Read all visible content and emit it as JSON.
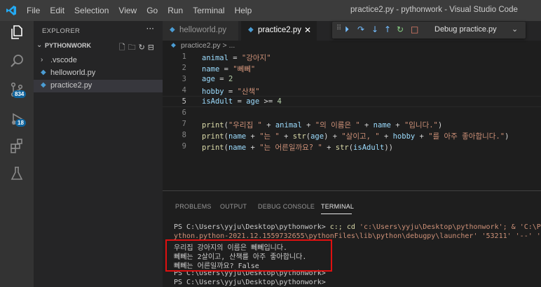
{
  "menu": [
    "File",
    "Edit",
    "Selection",
    "View",
    "Go",
    "Run",
    "Terminal",
    "Help"
  ],
  "window_title": "practice2.py - pythonwork - Visual Studio Code",
  "activity": {
    "scm_badge": "834",
    "debug_badge": "18"
  },
  "sidebar": {
    "title": "EXPLORER",
    "more": "···",
    "folder": "PYTHONWORK",
    "items": [
      {
        "label": ".vscode",
        "kind": "folder"
      },
      {
        "label": "helloworld.py",
        "kind": "python"
      },
      {
        "label": "practice2.py",
        "kind": "python"
      }
    ]
  },
  "tabs": [
    {
      "label": "helloworld.py",
      "active": false
    },
    {
      "label": "practice2.py",
      "active": true
    }
  ],
  "debug": {
    "config": "Debug practice.py"
  },
  "breadcrumb": "practice2.py > ...",
  "code_lines": [
    {
      "n": "1",
      "text": "animal = \"강아지\""
    },
    {
      "n": "2",
      "text": "name = \"뻬뻬\""
    },
    {
      "n": "3",
      "text": "age = 2"
    },
    {
      "n": "4",
      "text": "hobby = \"산책\""
    },
    {
      "n": "5",
      "text": "isAdult = age >= 4"
    },
    {
      "n": "6",
      "text": ""
    },
    {
      "n": "7",
      "text": "print(\"우리집 \" + animal + \"의 이름은 \" + name + \"입니다.\")"
    },
    {
      "n": "8",
      "text": "print(name + \"는 \" + str(age) + \"살이고, \" + hobby + \"를 아주 좋아합니다.\")"
    },
    {
      "n": "9",
      "text": "print(name + \"는 어른일까요? \" + str(isAdult))"
    }
  ],
  "panel": {
    "tabs": [
      "PROBLEMS",
      "OUTPUT",
      "DEBUG CONSOLE",
      "TERMINAL"
    ],
    "active_tab": "TERMINAL",
    "terminal": {
      "line1_prompt": "PS C:\\Users\\yyju\\Desktop\\pythonwork> ",
      "line1_cmd": "c:; cd ",
      "line1_rest": "'c:\\Users\\yyju\\Desktop\\pythonwork'; & 'C:\\Pyt",
      "line2": "ython.python-2021.12.1559732655\\pythonFiles\\lib\\python\\debugpy\\launcher' '53211' '--' 'c:\\",
      "out1": "우리집 강아지의 이름은 뻬뻬입니다.",
      "out2": "뻬뻬는 2살이고, 산책를 아주 좋아합니다.",
      "out3": "뻬뻬는 어른일까요? False",
      "line6": "PS C:\\Users\\yyju\\Desktop\\pythonwork>",
      "line7": "PS C:\\Users\\yyju\\Desktop\\pythonwork>"
    }
  },
  "colors": {
    "accent_blue": "#0e639c",
    "highlight_red": "#e01010"
  }
}
